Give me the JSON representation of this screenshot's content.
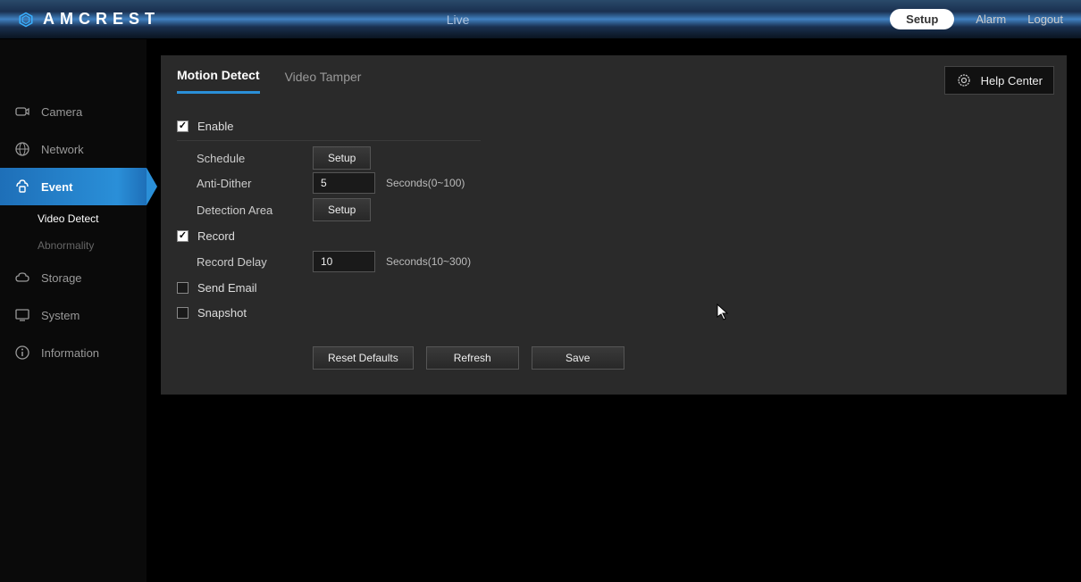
{
  "brand": "AMCREST",
  "header": {
    "center": "Live",
    "nav": {
      "setup": "Setup",
      "alarm": "Alarm",
      "logout": "Logout"
    }
  },
  "sidebar": {
    "camera": "Camera",
    "network": "Network",
    "event": "Event",
    "event_sub": {
      "video_detect": "Video Detect",
      "abnormality": "Abnormality"
    },
    "storage": "Storage",
    "system": "System",
    "information": "Information"
  },
  "tabs": {
    "motion_detect": "Motion Detect",
    "video_tamper": "Video Tamper"
  },
  "help_center": "Help Center",
  "form": {
    "enable": "Enable",
    "schedule": "Schedule",
    "schedule_btn": "Setup",
    "anti_dither": "Anti-Dither",
    "anti_dither_value": "5",
    "anti_dither_hint": "Seconds(0~100)",
    "detection_area": "Detection Area",
    "detection_area_btn": "Setup",
    "record": "Record",
    "record_delay": "Record Delay",
    "record_delay_value": "10",
    "record_delay_hint": "Seconds(10~300)",
    "send_email": "Send Email",
    "snapshot": "Snapshot"
  },
  "actions": {
    "reset_defaults": "Reset Defaults",
    "refresh": "Refresh",
    "save": "Save"
  }
}
